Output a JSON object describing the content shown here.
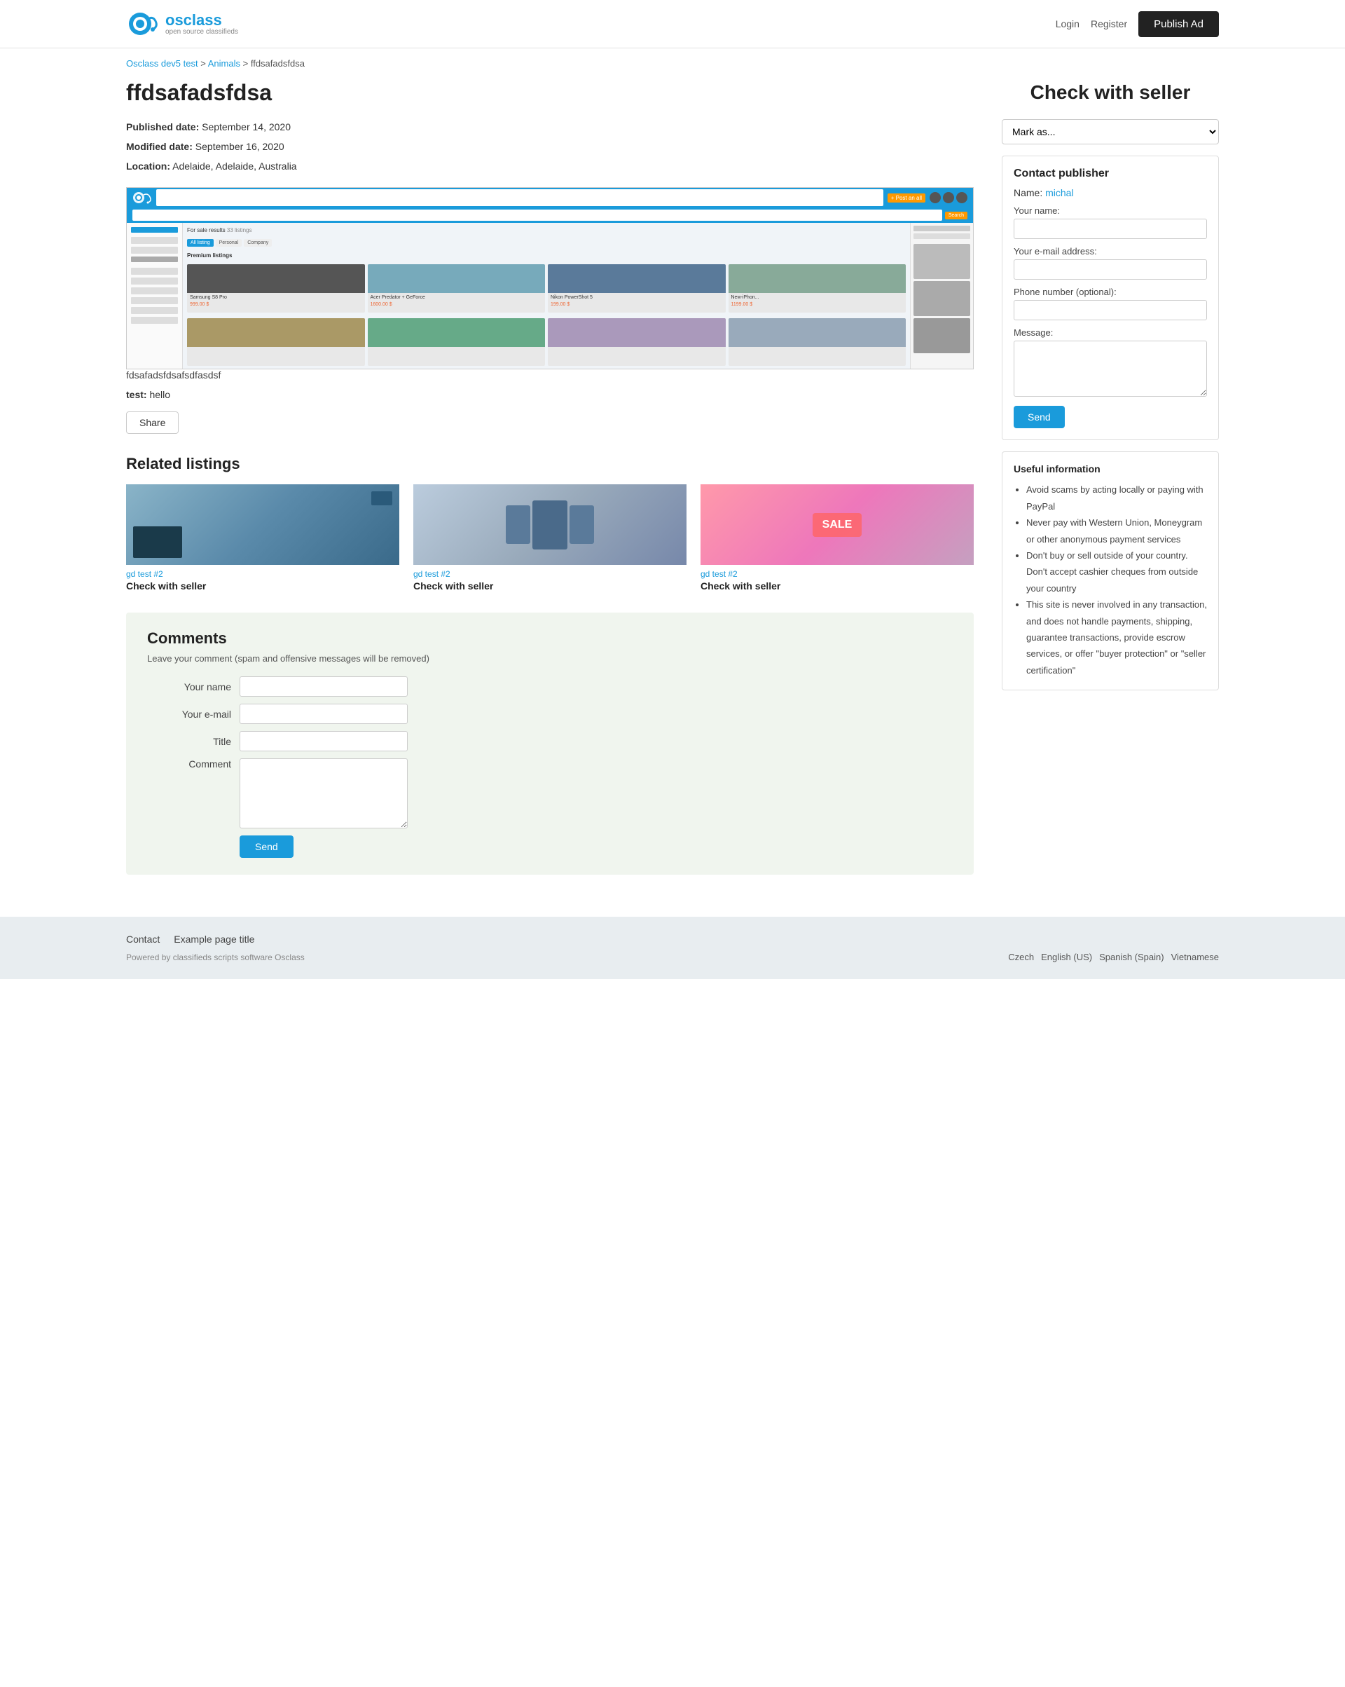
{
  "header": {
    "logo_name": "osclass",
    "logo_tagline": "open source classifieds",
    "nav": {
      "login": "Login",
      "register": "Register",
      "publish_ad": "Publish Ad"
    }
  },
  "breadcrumb": {
    "home": "Osclass dev5 test",
    "category": "Animals",
    "current": "ffdsafadsfdsa"
  },
  "listing": {
    "title": "ffdsafadsfdsa",
    "published_label": "Published date:",
    "published_date": "September 14, 2020",
    "modified_label": "Modified date:",
    "modified_date": "September 16, 2020",
    "location_label": "Location:",
    "location_value": "Adelaide, Adelaide, Australia",
    "description": "fdsafadsfdsafsdfasdsf",
    "extra_label": "test:",
    "extra_value": "hello",
    "share_btn": "Share"
  },
  "related": {
    "title": "Related listings",
    "items": [
      {
        "category": "gd test #2",
        "title": "Check with seller"
      },
      {
        "category": "gd test #2",
        "title": "Check with seller"
      },
      {
        "category": "gd test #2",
        "title": "Check with seller"
      }
    ]
  },
  "comments": {
    "title": "Comments",
    "subtitle": "Leave your comment (spam and offensive messages will be removed)",
    "fields": {
      "name_label": "Your name",
      "email_label": "Your e-mail",
      "title_label": "Title",
      "comment_label": "Comment"
    },
    "send_btn": "Send"
  },
  "sidebar": {
    "check_title": "Check with seller",
    "mark_placeholder": "Mark as...",
    "contact": {
      "title": "Contact publisher",
      "name_label": "Name:",
      "name_value": "michal",
      "your_name_label": "Your name:",
      "email_label": "Your e-mail address:",
      "phone_label": "Phone number (optional):",
      "message_label": "Message:",
      "send_btn": "Send"
    },
    "useful": {
      "title": "Useful information",
      "items": [
        "Avoid scams by acting locally or paying with PayPal",
        "Never pay with Western Union, Moneygram or other anonymous payment services",
        "Don't buy or sell outside of your country. Don't accept cashier cheques from outside your country",
        "This site is never involved in any transaction, and does not handle payments, shipping, guarantee transactions, provide escrow services, or offer \"buyer protection\" or \"seller certification\""
      ]
    }
  },
  "footer": {
    "links": [
      "Contact",
      "Example page title"
    ],
    "powered_text": "Powered by classifieds scripts software Osclass",
    "languages": [
      "Czech",
      "English (US)",
      "Spanish (Spain)",
      "Vietnamese"
    ]
  }
}
